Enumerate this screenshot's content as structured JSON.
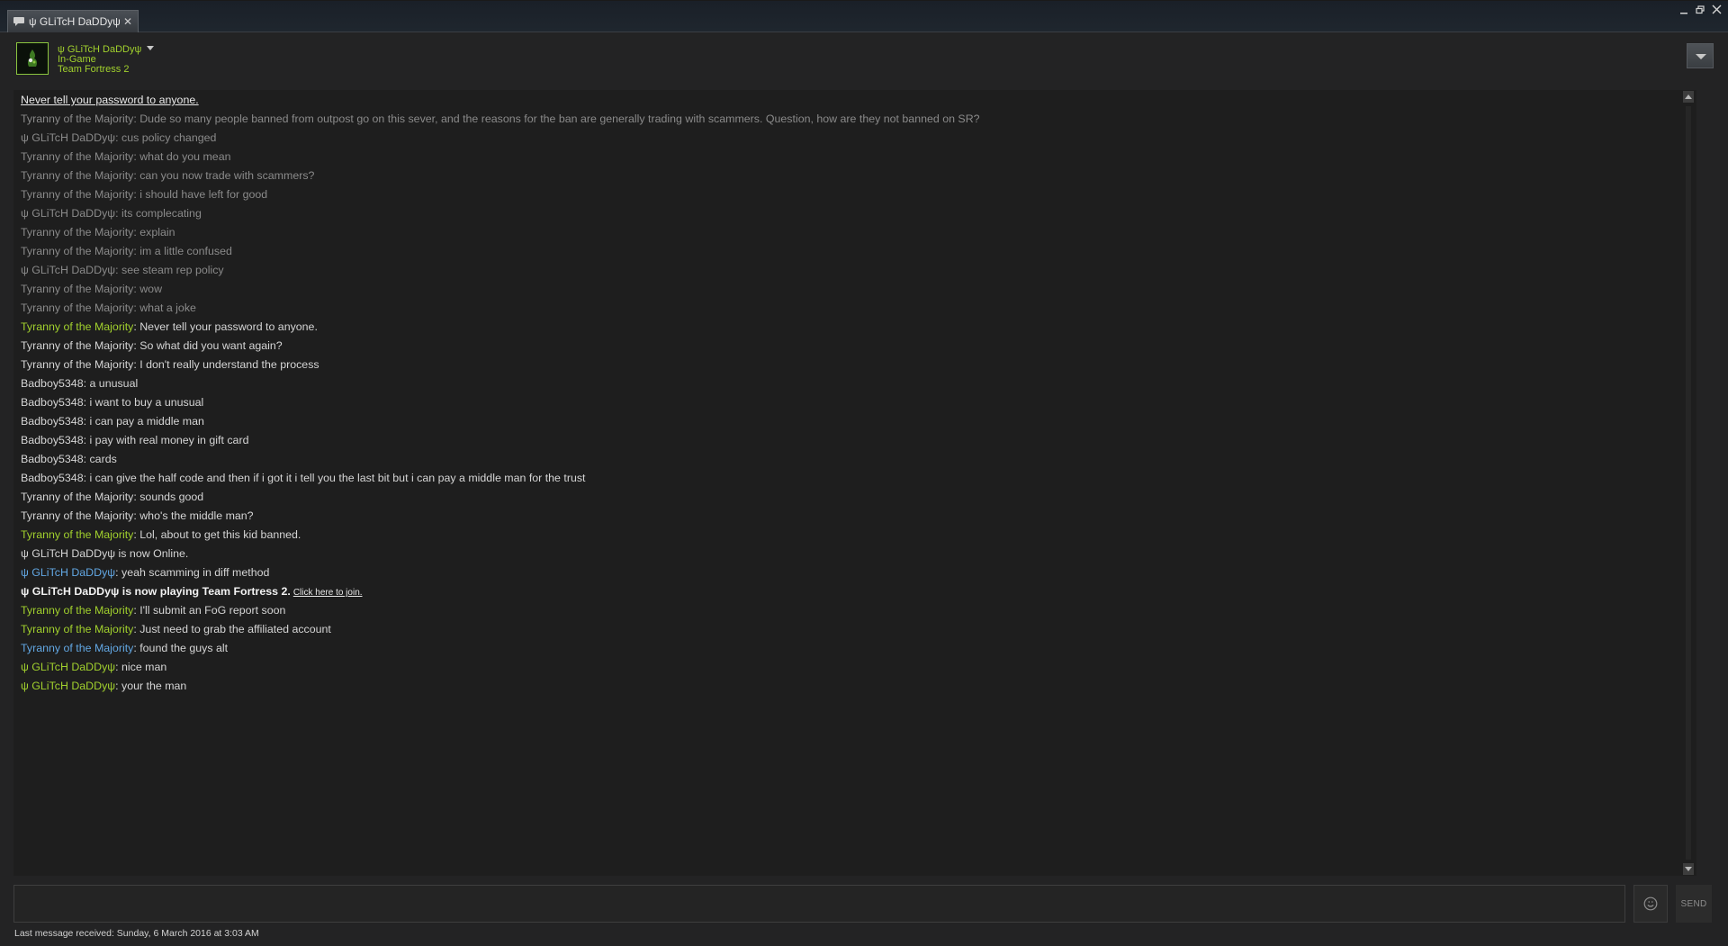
{
  "tab": {
    "title": "ψ GLiTcH DaDDyψ",
    "icon": "chat-bubble-icon"
  },
  "window_controls": {
    "minimize_icon": "minimize-icon",
    "restore_icon": "restore-icon",
    "close_icon": "close-icon"
  },
  "header": {
    "friend_name": "ψ GLiTcH DaDDyψ",
    "status": "In-Game",
    "game": "Team Fortress 2"
  },
  "chat": {
    "warning": "Never tell your password to anyone.",
    "messages": [
      {
        "speaker": "Tyranny of the Majority",
        "text": ": Dude so many people banned from outpost go on this sever, and the reasons for the ban are generally trading with scammers. Question, how are they not banned on SR?"
      },
      {
        "speaker": "ψ GLiTcH DaDDyψ",
        "text": ": cus policy changed"
      },
      {
        "speaker": "Tyranny of the Majority",
        "text": ": what do you mean"
      },
      {
        "speaker": "Tyranny of the Majority",
        "text": ": can you now trade with scammers?"
      },
      {
        "speaker": "Tyranny of the Majority",
        "text": ": i should have left for good"
      },
      {
        "speaker": "ψ GLiTcH DaDDyψ",
        "text": ": its complecating"
      },
      {
        "speaker": "Tyranny of the Majority",
        "text": ": explain"
      },
      {
        "speaker": "Tyranny of the Majority",
        "text": ": im a little confused"
      },
      {
        "speaker": "ψ GLiTcH DaDDyψ",
        "text": ": see steam rep policy"
      },
      {
        "speaker": "Tyranny of the Majority",
        "text": ": wow"
      },
      {
        "speaker": "Tyranny of the Majority",
        "text": ": what a joke"
      },
      {
        "speaker": "Tyranny of the Majority",
        "text": ": Never tell your password to anyone."
      },
      {
        "speaker": "Tyranny of the Majority",
        "text": ": So what did you want again?"
      },
      {
        "speaker": "Tyranny of the Majority",
        "text": ": I don't really understand the process"
      },
      {
        "speaker": "Badboy5348",
        "text": ": a unusual"
      },
      {
        "speaker": "Badboy5348",
        "text": ": i want to buy a unusual"
      },
      {
        "speaker": "Badboy5348",
        "text": ": i can pay a middle man"
      },
      {
        "speaker": "Badboy5348",
        "text": ": i pay with real money in gift card"
      },
      {
        "speaker": "Badboy5348",
        "text": ": cards"
      },
      {
        "speaker": "Badboy5348",
        "text": ": i can give the half code and then if i got it i tell you the last bit but i can pay a middle man for the trust"
      },
      {
        "speaker": "Tyranny of the Majority",
        "text": ": sounds good"
      },
      {
        "speaker": "Tyranny of the Majority",
        "text": ": who's the middle man?"
      },
      {
        "speaker": "Tyranny of the Majority",
        "text": ": Lol, about to get this kid banned."
      },
      {
        "speaker": "",
        "text": "ψ GLiTcH DaDDyψ is now Online."
      },
      {
        "speaker": "ψ GLiTcH DaDDyψ",
        "text": ": yeah scamming in diff method"
      },
      {
        "speaker": "",
        "text": "ψ GLiTcH DaDDyψ is now playing Team Fortress 2.",
        "link": "Click here to join."
      },
      {
        "speaker": "Tyranny of the Majority",
        "text": ": I'll submit an FoG report soon"
      },
      {
        "speaker": "Tyranny of the Majority",
        "text": ": Just need to grab the affiliated account"
      },
      {
        "speaker": "Tyranny of the Majority",
        "text": ": found the guys alt"
      },
      {
        "speaker": "ψ GLiTcH DaDDyψ",
        "text": ": nice man"
      },
      {
        "speaker": "ψ GLiTcH DaDDyψ",
        "text": ": your the man"
      }
    ]
  },
  "input": {
    "value": "",
    "send_label": "SEND",
    "emoticon_icon": "smiley-icon"
  },
  "footer": {
    "last_message": "Last message received: Sunday, 6 March 2016 at 3:03 AM"
  },
  "colors": {
    "in_game_green": "#a1d02d",
    "online_blue": "#62a7e3",
    "history_gray": "#8a8a8a",
    "text_light": "#d5d5d5"
  }
}
